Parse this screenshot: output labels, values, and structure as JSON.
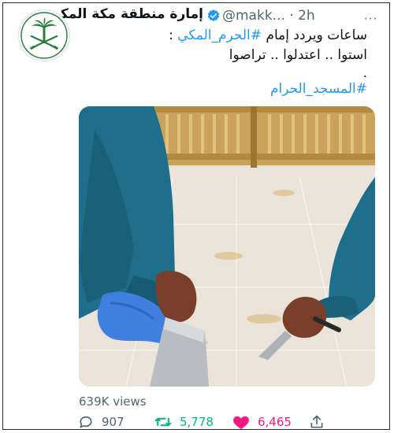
{
  "tweet": {
    "display_name": "إمارة منطقة مكة المكرمة",
    "handle": "@makk...",
    "time": "· 2h",
    "more_label": "···",
    "text_line1_prefix": "ساعات ويردد إمام ",
    "text_line1_hashtag": "#الحرم_المكي",
    "text_line1_suffix": " :",
    "text_line2": "استوا .. اعتدلوا .. تراصوا",
    "text_line3": ".",
    "hashtag_mosque": "#المسجد_الحرام"
  },
  "metrics": {
    "views": "639K views",
    "replies": "907",
    "retweets": "5,778",
    "likes": "6,465"
  },
  "icons": {
    "verified": "verified-badge-icon",
    "reply": "reply-icon",
    "retweet": "retweet-icon",
    "like": "heart-icon",
    "share": "share-icon",
    "more": "more-icon"
  },
  "colors": {
    "link": "#1d9bf0",
    "retweet": "#00ba7c",
    "like": "#f91880",
    "muted": "#536471",
    "text": "#0f1419"
  }
}
